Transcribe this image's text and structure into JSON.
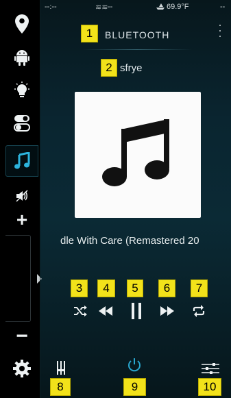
{
  "status_bar": {
    "time": "--:--",
    "wave_reading": "--",
    "temperature": "69.9°F",
    "right": "--"
  },
  "header": {
    "title": "BLUETOOTH",
    "subtitle": "sfrye"
  },
  "now_playing": {
    "track_title": "dle With Care (Remastered 20"
  },
  "nav_rail": {
    "items": [
      {
        "icon": "location-pin-icon",
        "active": false
      },
      {
        "icon": "android-icon",
        "active": false
      },
      {
        "icon": "light-bulb-icon",
        "active": false
      },
      {
        "icon": "toggle-switch-icon",
        "active": false
      },
      {
        "icon": "music-note-icon",
        "active": true
      }
    ],
    "mute_icon": "speaker-mute-icon",
    "volume_up": "+",
    "volume_down": "−",
    "volume_level": 0.0,
    "settings_icon": "gear-icon"
  },
  "controls": [
    "shuffle-icon",
    "rewind-icon",
    "pause-icon",
    "fast-forward-icon",
    "repeat-icon"
  ],
  "bottom_bar": [
    "equalizer-bars-icon",
    "power-icon",
    "sliders-icon"
  ],
  "callouts": [
    "1",
    "2",
    "3",
    "4",
    "5",
    "6",
    "7",
    "8",
    "9",
    "10"
  ],
  "colors": {
    "accent": "#29a7cf",
    "callout": "#f2e21a",
    "panel": "#0b2a35"
  }
}
